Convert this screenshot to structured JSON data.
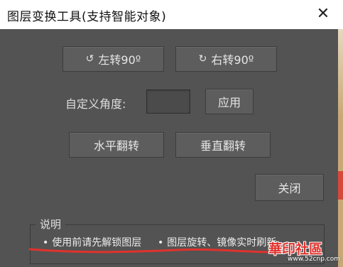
{
  "window": {
    "title": "图层变换工具(支持智能对象)",
    "close_glyph": "✕"
  },
  "rotate": {
    "left_icon": "↺",
    "left_label": "左转90º",
    "right_icon": "↻",
    "right_label": "右转90º"
  },
  "custom_angle": {
    "label": "自定义角度:",
    "value": "",
    "apply_label": "应用"
  },
  "flip": {
    "horizontal_label": "水平翻转",
    "vertical_label": "垂直翻转"
  },
  "close_label": "关闭",
  "notes": {
    "title": "说明",
    "bullet": "•",
    "items": [
      "使用前请先解锁图层",
      "图层旋转、镜像实时刷新"
    ]
  },
  "watermark": {
    "text": "華印社區",
    "url": "www.52cnp.com"
  },
  "colors": {
    "panel_bg": "#535353",
    "button_bg": "#5d5d5d",
    "annotation": "#e0322d"
  }
}
